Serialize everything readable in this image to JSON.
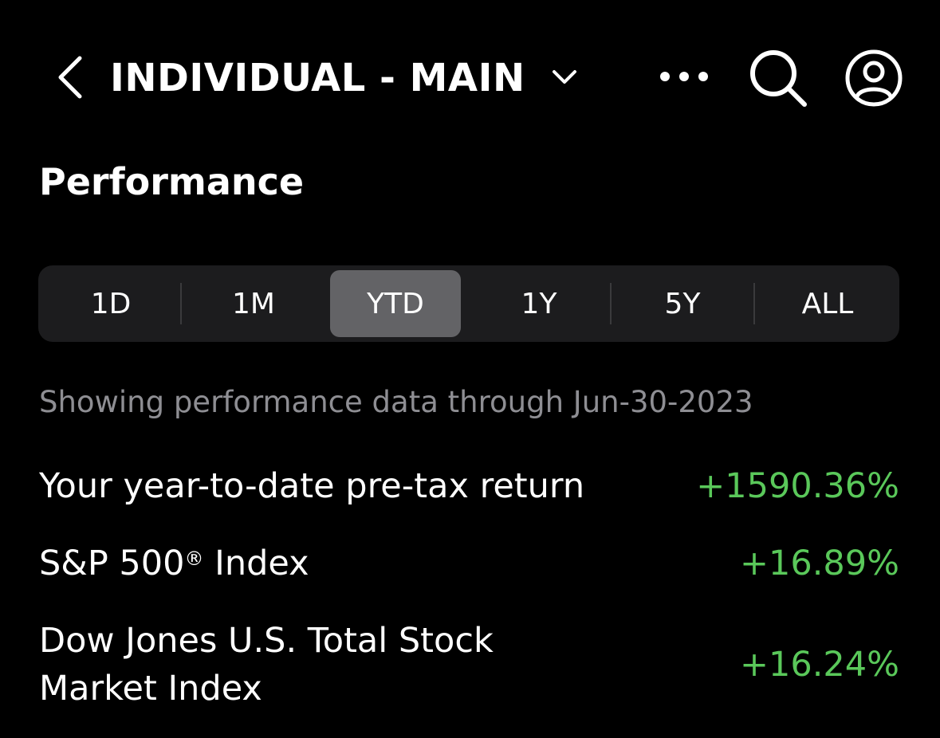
{
  "header": {
    "account_title": "INDIVIDUAL - MAIN",
    "icons": [
      "back-chevron-icon",
      "chevron-down-icon",
      "more-icon",
      "search-icon",
      "profile-icon"
    ]
  },
  "section": {
    "title": "Performance"
  },
  "range_tabs": {
    "items": [
      {
        "label": "1D"
      },
      {
        "label": "1M"
      },
      {
        "label": "YTD"
      },
      {
        "label": "1Y"
      },
      {
        "label": "5Y"
      },
      {
        "label": "ALL"
      }
    ],
    "selected": "YTD"
  },
  "note": "Showing performance data through Jun-30-2023",
  "rows": [
    {
      "label": "Your year-to-date pre-tax return",
      "value": "+1590.36%"
    },
    {
      "label_main": "S&P 500",
      "label_mark": "®",
      "label_tail": " Index",
      "value": "+16.89%"
    },
    {
      "label_line1": "Dow Jones U.S. Total Stock",
      "label_line2": "Market Index",
      "value": "+16.24%"
    }
  ],
  "colors": {
    "background": "#000000",
    "positive": "#5ac85a",
    "muted_text": "#8e8e93",
    "segment_bg": "#1c1c1e",
    "segment_active": "#636366"
  }
}
